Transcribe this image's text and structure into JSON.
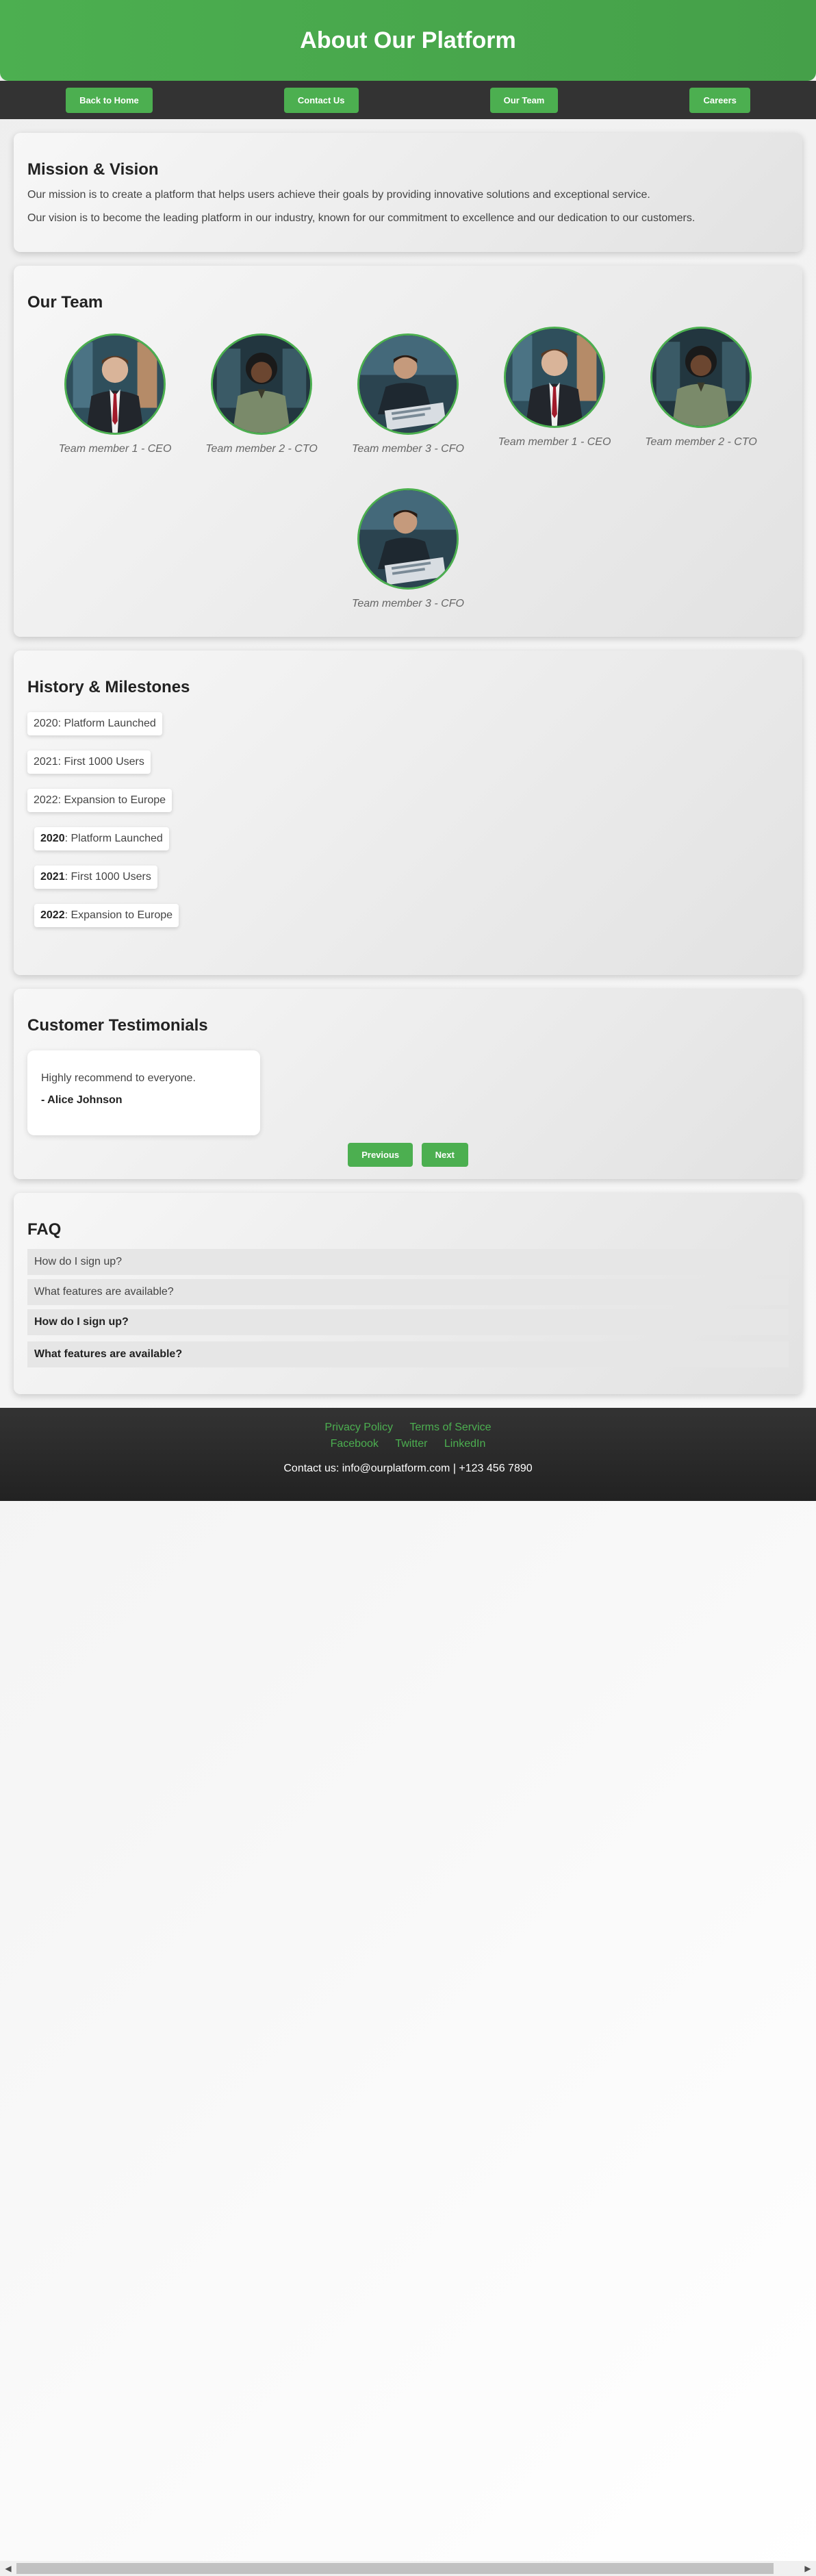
{
  "header": {
    "title": "About Our Platform"
  },
  "nav": {
    "items": [
      {
        "label": "Back to Home"
      },
      {
        "label": "Contact Us"
      },
      {
        "label": "Our Team"
      },
      {
        "label": "Careers"
      }
    ]
  },
  "mission": {
    "title": "Mission & Vision",
    "paragraphs": [
      "Our mission is to create a platform that helps users achieve their goals by providing innovative solutions and exceptional service.",
      "Our vision is to become the leading platform in our industry, known for our commitment to excellence and our dedication to our customers."
    ]
  },
  "team": {
    "title": "Our Team",
    "members": [
      {
        "caption": "Team member 1 - CEO"
      },
      {
        "caption": "Team member 2 - CTO"
      },
      {
        "caption": "Team member 3 - CFO"
      },
      {
        "caption": "Team member 1 - CEO"
      },
      {
        "caption": "Team member 2 - CTO"
      },
      {
        "caption": "Team member 3 - CFO"
      }
    ]
  },
  "history": {
    "title": "History & Milestones",
    "plain_items": [
      {
        "text": "2020: Platform Launched"
      },
      {
        "text": "2021: First 1000 Users"
      },
      {
        "text": "2022: Expansion to Europe"
      }
    ],
    "bold_items": [
      {
        "year": "2020",
        "text": ": Platform Launched"
      },
      {
        "year": "2021",
        "text": ": First 1000 Users"
      },
      {
        "year": "2022",
        "text": ": Expansion to Europe"
      }
    ]
  },
  "testimonials": {
    "title": "Customer Testimonials",
    "quote": "Highly recommend to everyone.",
    "author": "- Alice Johnson",
    "prev_label": "Previous",
    "next_label": "Next"
  },
  "faq": {
    "title": "FAQ",
    "items": [
      {
        "q": "How do I sign up?"
      },
      {
        "q": "What features are available?"
      }
    ],
    "bold_items": [
      {
        "q": "How do I sign up?"
      },
      {
        "q": "What features are available?"
      }
    ]
  },
  "footer": {
    "links_row1": [
      "Privacy Policy",
      "Terms of Service"
    ],
    "links_row2": [
      "Facebook",
      "Twitter",
      "LinkedIn"
    ],
    "contact": "Contact us: info@ourplatform.com | +123 456 7890"
  },
  "colors": {
    "accent": "#4caf50",
    "nav_bg": "#333333",
    "footer_bg": "#222222"
  }
}
